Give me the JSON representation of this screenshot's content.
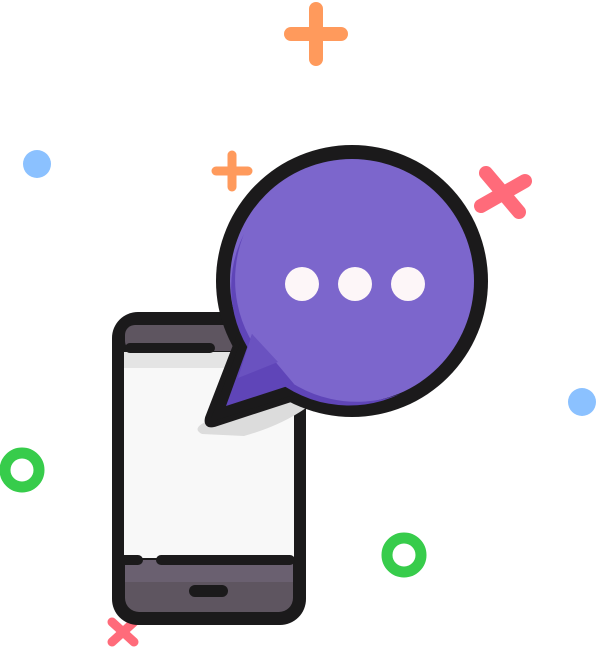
{
  "illustration": {
    "subject": "smartphone-with-chat-bubble",
    "icons": [
      "smartphone-icon",
      "chat-bubble-icon",
      "typing-dots-icon"
    ],
    "typing_dot_count": 3,
    "colors": {
      "outline": "#1b1a1b",
      "phone_screen": "#f8f8f8",
      "phone_bezel": "#5e5560",
      "screen_shadow": "#dcdcdc",
      "bubble_fill": "#7c66cc",
      "bubble_shade": "#5f45b8",
      "dots": "#fdf6f8",
      "plus_orange": "#ff9a5c",
      "cross_red": "#ff6b7a",
      "circle_blue": "#8bc1ff",
      "ring_green": "#37cc4b"
    },
    "decorations": [
      "plus-orange-large",
      "plus-orange-small",
      "cross-red-large",
      "cross-red-small",
      "dot-blue-left",
      "dot-blue-right",
      "ring-green-left",
      "ring-green-bottom"
    ]
  }
}
